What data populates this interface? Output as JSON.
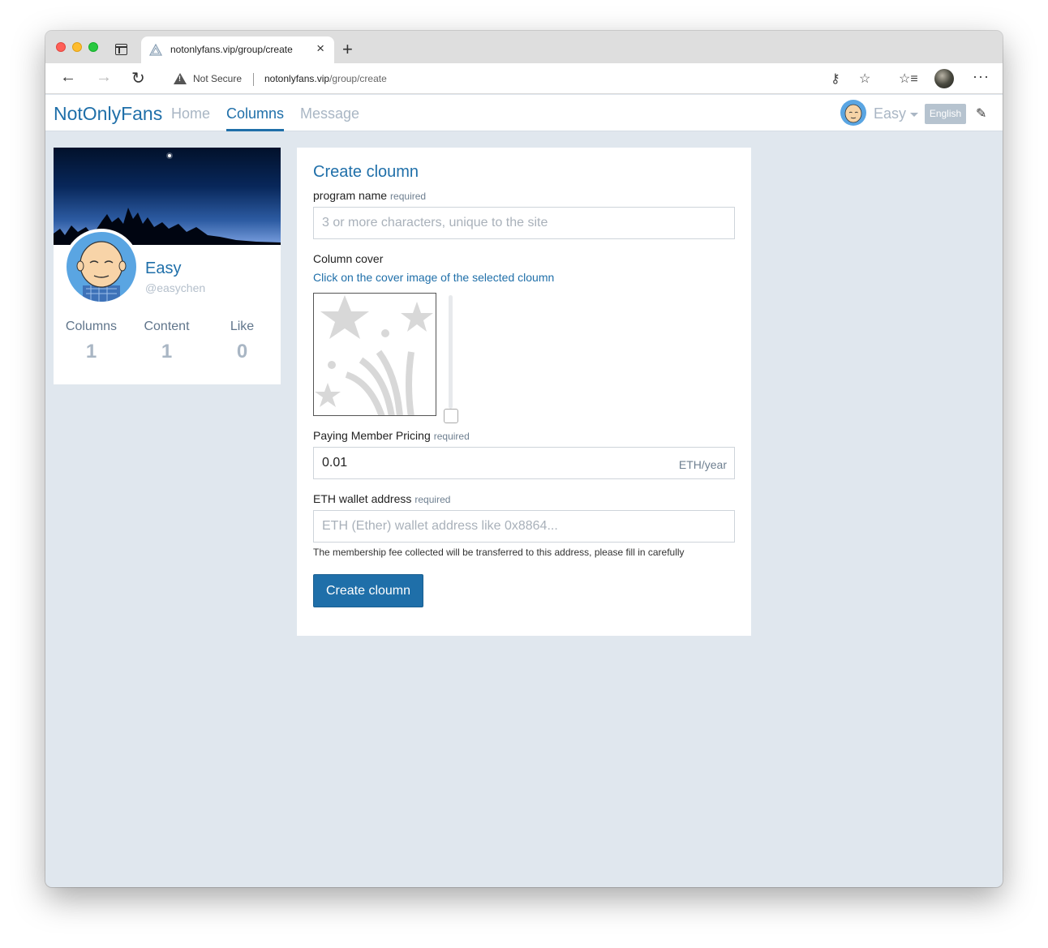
{
  "browser": {
    "tab_title": "notonlyfans.vip/group/create",
    "security_label": "Not Secure",
    "url_host": "notonlyfans.vip",
    "url_path": "/group/create"
  },
  "nav": {
    "brand": "NotOnlyFans",
    "links": [
      "Home",
      "Columns",
      "Message"
    ],
    "active": "Columns",
    "user_name": "Easy",
    "language_button": "English"
  },
  "profile": {
    "name": "Easy",
    "handle": "@easychen",
    "stats": [
      {
        "label": "Columns",
        "value": "1"
      },
      {
        "label": "Content",
        "value": "1"
      },
      {
        "label": "Like",
        "value": "0"
      }
    ]
  },
  "form": {
    "title": "Create cloumn",
    "required_tag": "required",
    "program_name_label": "program name",
    "program_name_placeholder": "3 or more characters, unique to the site",
    "cover_label": "Column cover",
    "cover_hint": "Click on the cover image of the selected cloumn",
    "pricing_label": "Paying Member Pricing",
    "pricing_value": "0.01",
    "pricing_suffix": "ETH/year",
    "wallet_label": "ETH wallet address",
    "wallet_placeholder": "ETH (Ether) wallet address like 0x8864...",
    "wallet_helper": "The membership fee collected will be transferred to this address, please fill in carefully",
    "submit_label": "Create cloumn"
  },
  "colors": {
    "brand": "#1f6fa9",
    "muted_nav": "#a9b6c4",
    "page_bg": "#e0e7ee"
  }
}
